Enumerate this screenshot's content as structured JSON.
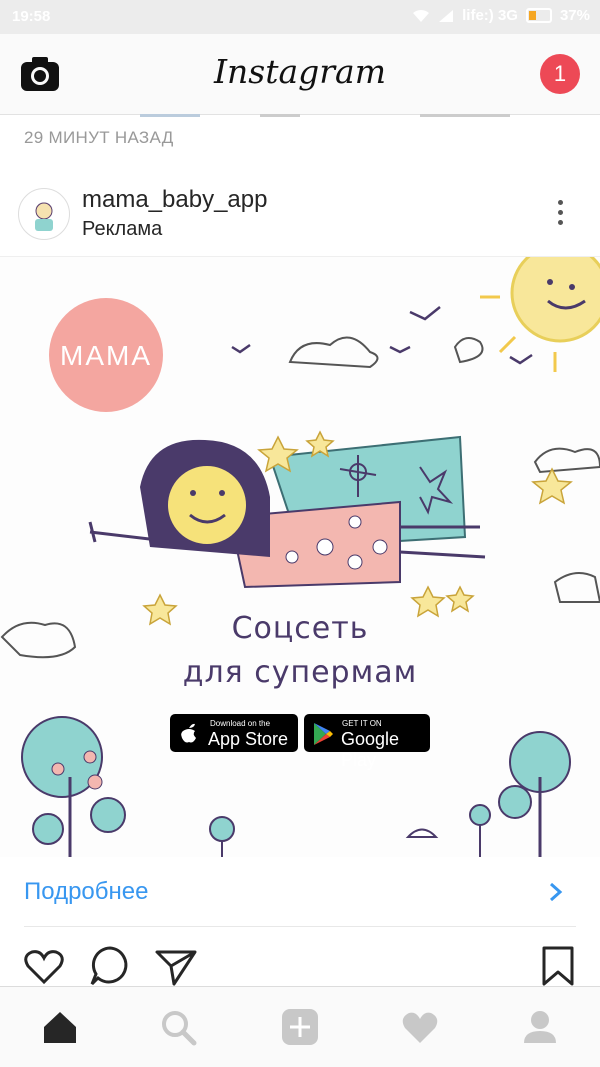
{
  "status": {
    "time": "19:58",
    "carrier": "life:) 3G",
    "battery": "37%",
    "battery_level": 0.37
  },
  "header": {
    "logo": "Instagram",
    "notification_count": "1"
  },
  "previous_post": {
    "time_ago": "29 МИНУТ НАЗАД"
  },
  "post": {
    "username": "mama_baby_app",
    "sponsored_label": "Реклама",
    "image": {
      "badge_text": "MAMA",
      "tagline_line1": "Соцсеть",
      "tagline_line2": "для супермам",
      "app_store": {
        "small": "Download on the",
        "big": "App Store"
      },
      "google_play": {
        "small": "GET IT ON",
        "big": "Google Play"
      }
    },
    "cta_label": "Подробнее"
  },
  "icons": {
    "camera": "camera-icon",
    "more": "more-vertical-icon",
    "like": "heart-icon",
    "comment": "comment-icon",
    "share": "send-icon",
    "save": "bookmark-icon",
    "nav": [
      "home-icon",
      "search-icon",
      "add-icon",
      "activity-icon",
      "profile-icon"
    ]
  },
  "colors": {
    "accent": "#3897f0",
    "badge": "#ed4956",
    "tagline": "#4a3a6a"
  }
}
